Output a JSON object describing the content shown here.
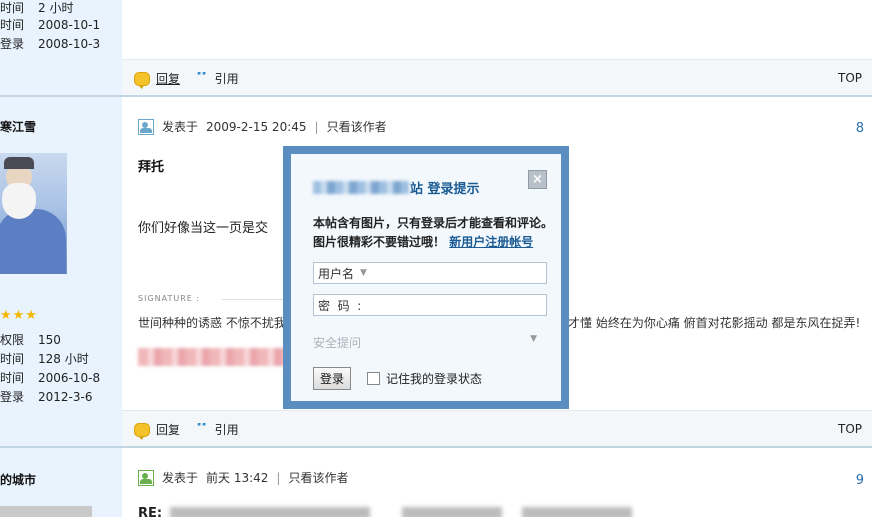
{
  "post1": {
    "author_stats": [
      {
        "label": "时间",
        "value": "2 小时"
      },
      {
        "label": "时间",
        "value": "2008-10-1"
      },
      {
        "label": "登录",
        "value": "2008-10-3"
      }
    ]
  },
  "post2": {
    "author_name": "寒江雪",
    "meta": {
      "posted_prefix": "发表于",
      "datetime": "2009-2-15 20:45",
      "separator": "|",
      "only_author": "只看该作者"
    },
    "floor": "8",
    "title": "拜托",
    "body": "你们好像当这一页是交",
    "signature_label": "SIGNATURE :",
    "signature_text_left": "世间种种的诱惑 不惊不扰我",
    "signature_text_right": "才懂  始终在为你心痛 俯首对花影摇动  都是东风在捉弄!",
    "author_stats": [
      {
        "label": "权限",
        "value": "150"
      },
      {
        "label": "时间",
        "value": "128 小时"
      },
      {
        "label": "时间",
        "value": "2006-10-8"
      },
      {
        "label": "登录",
        "value": "2012-3-6"
      }
    ]
  },
  "post3": {
    "author_name": "的城市",
    "meta": {
      "posted_prefix": "发表于",
      "datetime": "前天 13:42",
      "separator": "|",
      "only_author": "只看该作者"
    },
    "floor": "9",
    "title_prefix": "RE:"
  },
  "actions": {
    "reply": "回复",
    "quote": "引用",
    "top": "TOP"
  },
  "login_modal": {
    "title_suffix": "站 登录提示",
    "close": "×",
    "message_line1": "本帖含有图片，只有登录后才能查看和评论。",
    "message_line2": "图片很精彩不要错过哦！",
    "register_link": "新用户注册帐号",
    "username_label": "用户名",
    "password_label": "密  码  :",
    "security_question": "安全提问",
    "login_button": "登录",
    "remember_label": "记住我的登录状态"
  },
  "colors": {
    "accent": "#1a5b94",
    "modal_border": "#5b8ec0",
    "left_column": "#e8f3fd",
    "divider": "#c2d5e3"
  }
}
